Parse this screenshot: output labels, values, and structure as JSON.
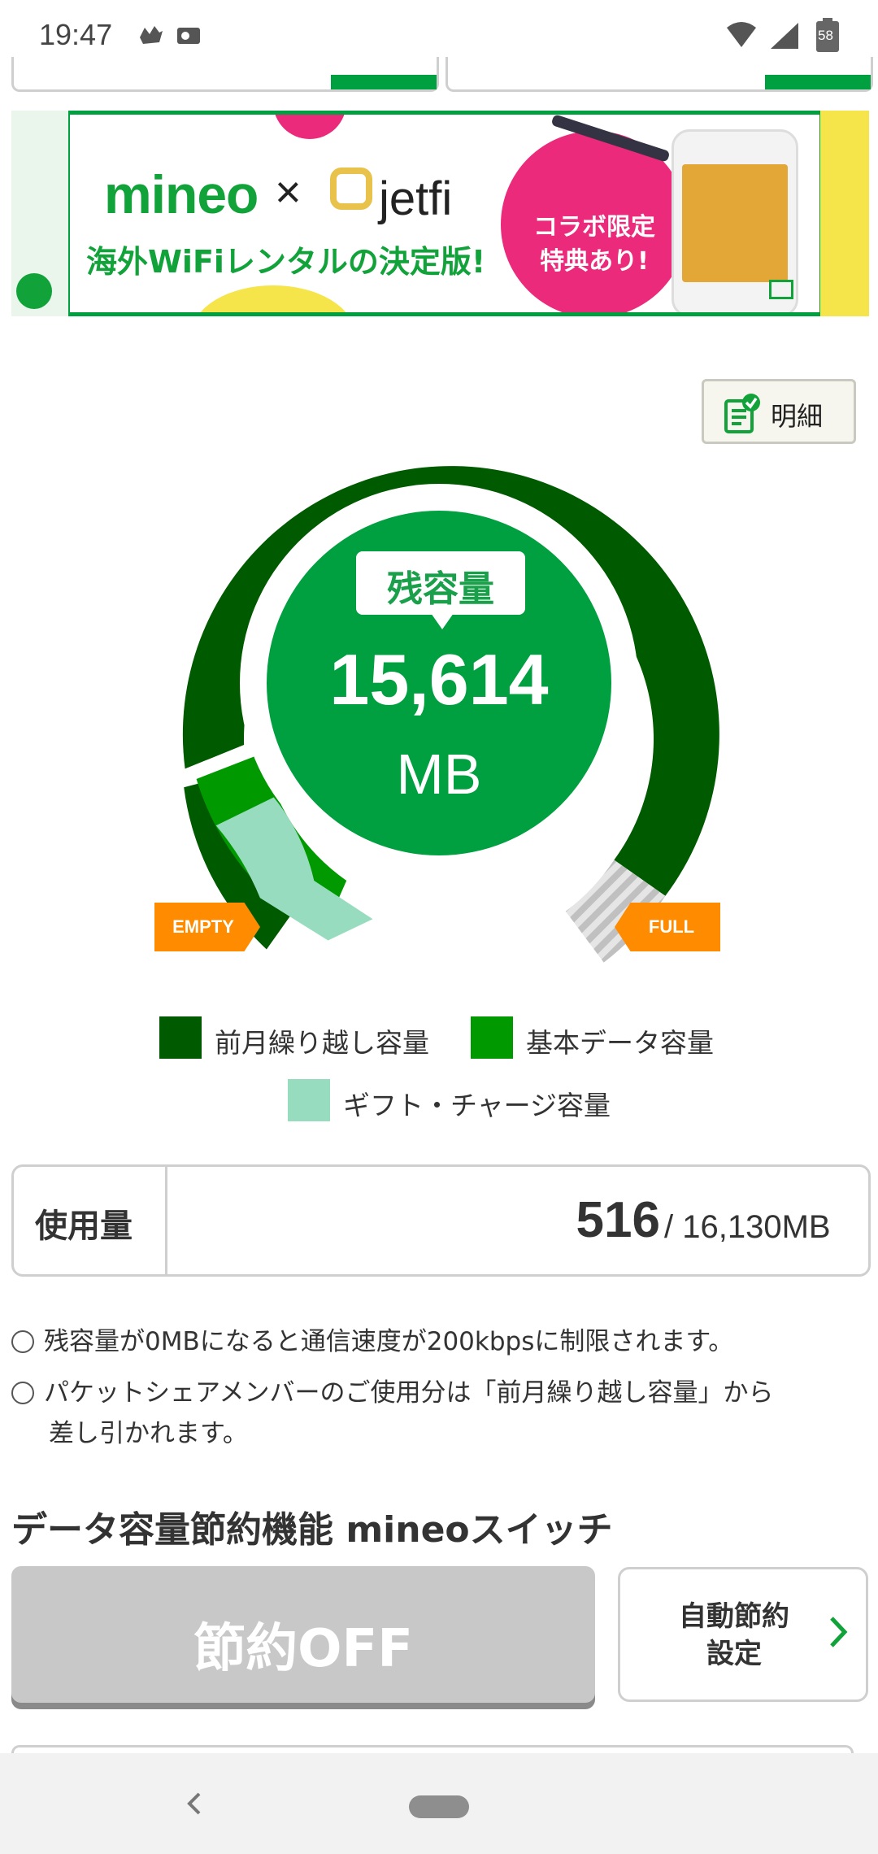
{
  "status_bar": {
    "time": "19:47",
    "battery": "58"
  },
  "banner": {
    "brand": "mineo",
    "times": "×",
    "partner": "jetfi",
    "subtitle": "海外WiFiレンタルの決定版!",
    "promo": "コラボ限定\n特典あり!"
  },
  "detail_button": {
    "label": "明細"
  },
  "gauge": {
    "label": "残容量",
    "value": "15,614",
    "unit": "MB",
    "empty_label": "EMPTY",
    "full_label": "FULL",
    "colors": {
      "carryover": "#005a00",
      "basic": "#009a00",
      "gift": "#98dcc0",
      "center": "#00a040"
    }
  },
  "legend": {
    "carryover": "前月繰り越し容量",
    "basic": "基本データ容量",
    "gift": "ギフト・チャージ容量"
  },
  "usage": {
    "label": "使用量",
    "used": "516",
    "total": "/ 16,130MB"
  },
  "notes": [
    "残容量が0MBになると通信速度が200kbpsに制限されます。",
    "パケットシェアメンバーのご使用分は「前月繰り越し容量」から",
    "差し引かれます。"
  ],
  "switch_section": {
    "title": "データ容量節約機能 mineoスイッチ",
    "off_button": "節約OFF",
    "auto_button_line1": "自動節約",
    "auto_button_line2": "設定"
  }
}
